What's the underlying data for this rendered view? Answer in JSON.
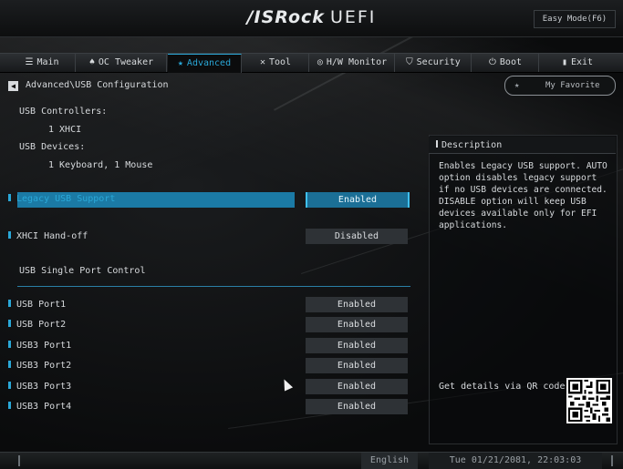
{
  "header": {
    "logo_brand": "/ISRock",
    "logo_product": "UEFI",
    "easy_mode": "Easy Mode(F6)"
  },
  "menu": {
    "tabs": [
      {
        "label": "Main",
        "icon": "list-icon"
      },
      {
        "label": "OC Tweaker",
        "icon": "rocket-icon"
      },
      {
        "label": "Advanced",
        "icon": "star-icon"
      },
      {
        "label": "Tool",
        "icon": "tools-icon"
      },
      {
        "label": "H/W Monitor",
        "icon": "monitor-icon"
      },
      {
        "label": "Security",
        "icon": "shield-icon"
      },
      {
        "label": "Boot",
        "icon": "power-icon"
      },
      {
        "label": "Exit",
        "icon": "exit-icon"
      }
    ],
    "active": "Advanced"
  },
  "breadcrumb": "Advanced\\USB Configuration",
  "favorite": {
    "label": "My Favorite"
  },
  "info": {
    "controllers_label": "USB Controllers:",
    "controllers_value": "1 XHCI",
    "devices_label": "USB Devices:",
    "devices_value": "1 Keyboard, 1 Mouse"
  },
  "settings": {
    "legacy": {
      "label": "Legacy USB Support",
      "value": "Enabled"
    },
    "xhci": {
      "label": "XHCI Hand-off",
      "value": "Disabled"
    },
    "section": "USB Single Port Control",
    "ports": [
      {
        "label": "USB Port1",
        "value": "Enabled"
      },
      {
        "label": "USB Port2",
        "value": "Enabled"
      },
      {
        "label": "USB3 Port1",
        "value": "Enabled"
      },
      {
        "label": "USB3 Port2",
        "value": "Enabled"
      },
      {
        "label": "USB3 Port3",
        "value": "Enabled"
      },
      {
        "label": "USB3 Port4",
        "value": "Enabled"
      }
    ]
  },
  "description": {
    "title": "Description",
    "text": "Enables Legacy USB support. AUTO option disables legacy support if no USB devices are connected. DISABLE option will keep USB devices available only for EFI applications.",
    "qr_label": "Get details via QR code"
  },
  "footer": {
    "language": "English",
    "datetime": "Tue 01/21/2081, 22:03:03"
  },
  "colors": {
    "accent": "#2aa8d8",
    "selected_bg": "#1b7aa5"
  }
}
